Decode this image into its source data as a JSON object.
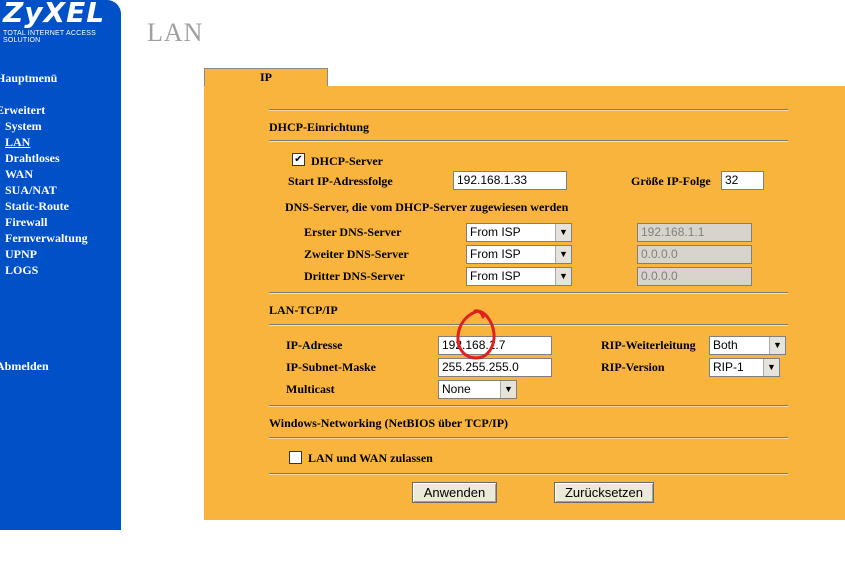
{
  "brand": {
    "logo": "ZyXEL",
    "tagline": "TOTAL INTERNET ACCESS SOLUTION"
  },
  "nav": {
    "main": "Hauptmenü",
    "advanced": "Erweitert",
    "items": [
      "System",
      "LAN",
      "Drahtloses",
      "WAN",
      "SUA/NAT",
      "Static-Route",
      "Firewall",
      "Fernverwaltung",
      "UPNP",
      "LOGS"
    ],
    "active": "LAN",
    "logout": "Abmelden"
  },
  "page": {
    "title": "LAN",
    "tab": "IP"
  },
  "dhcp": {
    "heading": "DHCP-Einrichtung",
    "server_label": "DHCP-Server",
    "server_checked": true,
    "start_label": "Start IP-Adressfolge",
    "start_value": "192.168.1.33",
    "size_label": "Größe IP-Folge",
    "size_value": "32",
    "dns_heading": "DNS-Server, die vom DHCP-Server zugewiesen werden",
    "dns": [
      {
        "label": "Erster DNS-Server",
        "mode": "From ISP",
        "ip": "192.168.1.1"
      },
      {
        "label": "Zweiter DNS-Server",
        "mode": "From ISP",
        "ip": "0.0.0.0"
      },
      {
        "label": "Dritter DNS-Server",
        "mode": "From ISP",
        "ip": "0.0.0.0"
      }
    ]
  },
  "lan_tcpip": {
    "heading": "LAN-TCP/IP",
    "ip_label": "IP-Adresse",
    "ip_value": "192.168.1.7",
    "subnet_label": "IP-Subnet-Maske",
    "subnet_value": "255.255.255.0",
    "multicast_label": "Multicast",
    "multicast_value": "None",
    "rip_dir_label": "RIP-Weiterleitung",
    "rip_dir_value": "Both",
    "rip_ver_label": "RIP-Version",
    "rip_ver_value": "RIP-1"
  },
  "netbios": {
    "heading": "Windows-Networking (NetBIOS über TCP/IP)",
    "allow_label": "LAN und WAN zulassen",
    "allow_checked": false
  },
  "buttons": {
    "apply": "Anwenden",
    "reset": "Zurücksetzen"
  },
  "colors": {
    "sidebar": "#0050c8",
    "panel": "#f8b43c",
    "annotation": "#e0201e"
  }
}
